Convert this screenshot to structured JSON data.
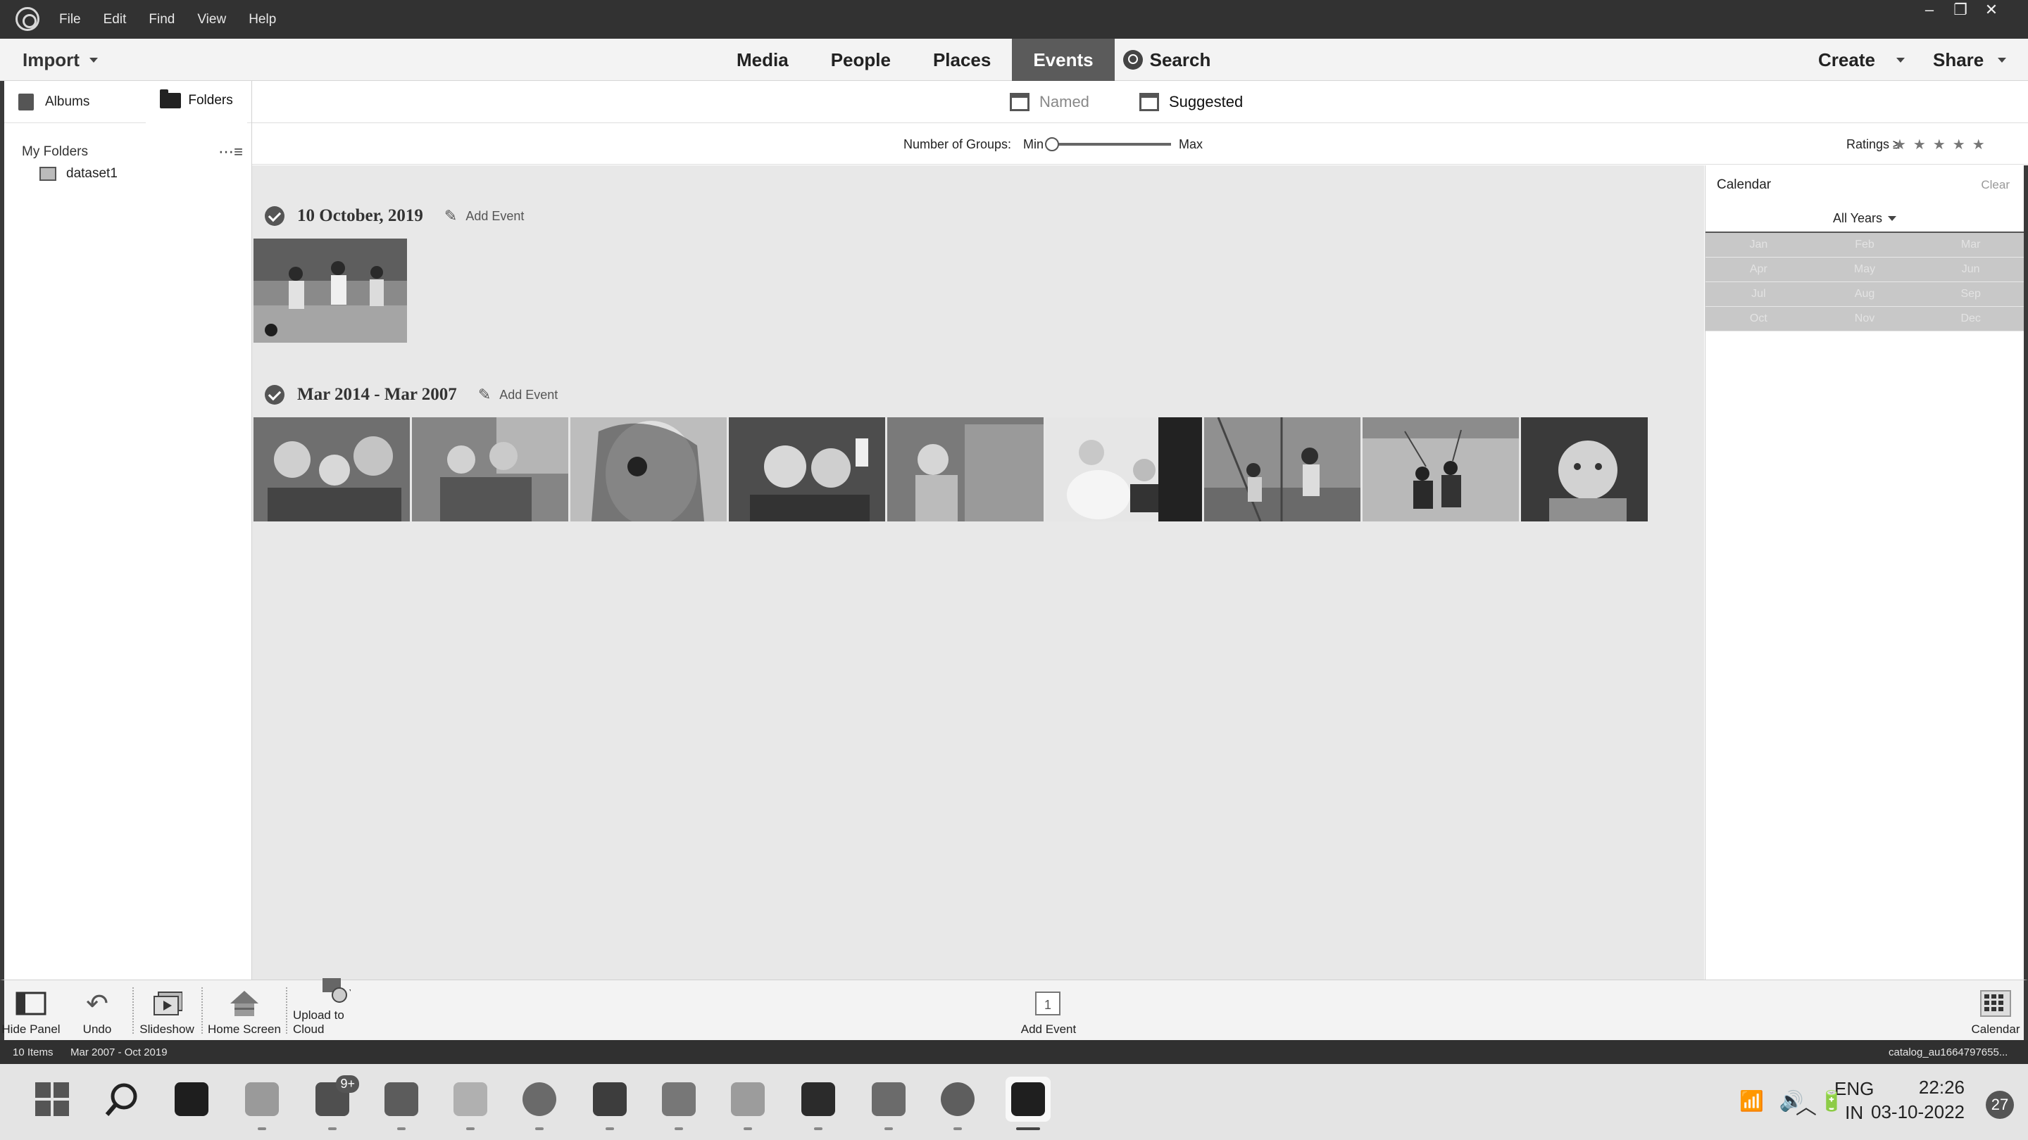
{
  "menu": [
    "File",
    "Edit",
    "Find",
    "View",
    "Help"
  ],
  "window_controls": [
    "–",
    "❐",
    "✕"
  ],
  "nav": {
    "import_label": "Import",
    "tabs": [
      "Media",
      "People",
      "Places",
      "Events"
    ],
    "active_tab": "Events",
    "search_label": "Search",
    "create_label": "Create",
    "share_label": "Share"
  },
  "left_panel": {
    "albums_label": "Albums",
    "folders_label": "Folders",
    "my_folders_label": "My Folders",
    "folders": [
      "dataset1"
    ]
  },
  "subtabs": {
    "named_label": "Named",
    "suggested_label": "Suggested",
    "active": "Suggested"
  },
  "groups_bar": {
    "label": "Number of Groups:",
    "min_label": "Min",
    "max_label": "Max",
    "slider_value_fraction": 0.0,
    "ratings_label": "Ratings ≥",
    "stars": "★★★★★"
  },
  "events": [
    {
      "title": "10 October, 2019",
      "add_event_label": "Add Event",
      "photo_count": 1,
      "photos": [
        "soccer-players"
      ]
    },
    {
      "title": "Mar 2014 - Mar 2007",
      "add_event_label": "Add Event",
      "photo_count": 9,
      "photos": [
        "kids-group",
        "two-girls-reading",
        "girl-peeking",
        "selfie-friends",
        "toddler-chair",
        "wedding-kids",
        "kids-playground",
        "two-kids-lake",
        "baby-portrait"
      ]
    }
  ],
  "calendar": {
    "title": "Calendar",
    "clear_label": "Clear",
    "years_label": "All Years",
    "months": [
      [
        "Jan",
        "Feb",
        "Mar"
      ],
      [
        "Apr",
        "May",
        "Jun"
      ],
      [
        "Jul",
        "Aug",
        "Sep"
      ],
      [
        "Oct",
        "Nov",
        "Dec"
      ]
    ]
  },
  "toolbar": {
    "hide_panel": "Hide Panel",
    "undo": "Undo",
    "slideshow": "Slideshow",
    "home_screen": "Home Screen",
    "upload_cloud": "Upload to Cloud",
    "add_event": "Add Event",
    "calendar": "Calendar"
  },
  "status": {
    "items": "10 Items",
    "range": "Mar 2007 - Oct 2019",
    "catalog": "catalog_au1664797655..."
  },
  "taskbar": {
    "apps": [
      "start",
      "search",
      "terminal",
      "file-explorer",
      "teams",
      "outlook",
      "notepad",
      "chrome",
      "vscode",
      "slack",
      "resource-monitor",
      "photoshop-elements-organizer",
      "presentation",
      "settings",
      "photoshop-elements"
    ],
    "teams_badge": "9+",
    "lang_line1": "ENG",
    "lang_line2": "IN",
    "time": "22:26",
    "date": "03-10-2022",
    "notifications": "27"
  }
}
